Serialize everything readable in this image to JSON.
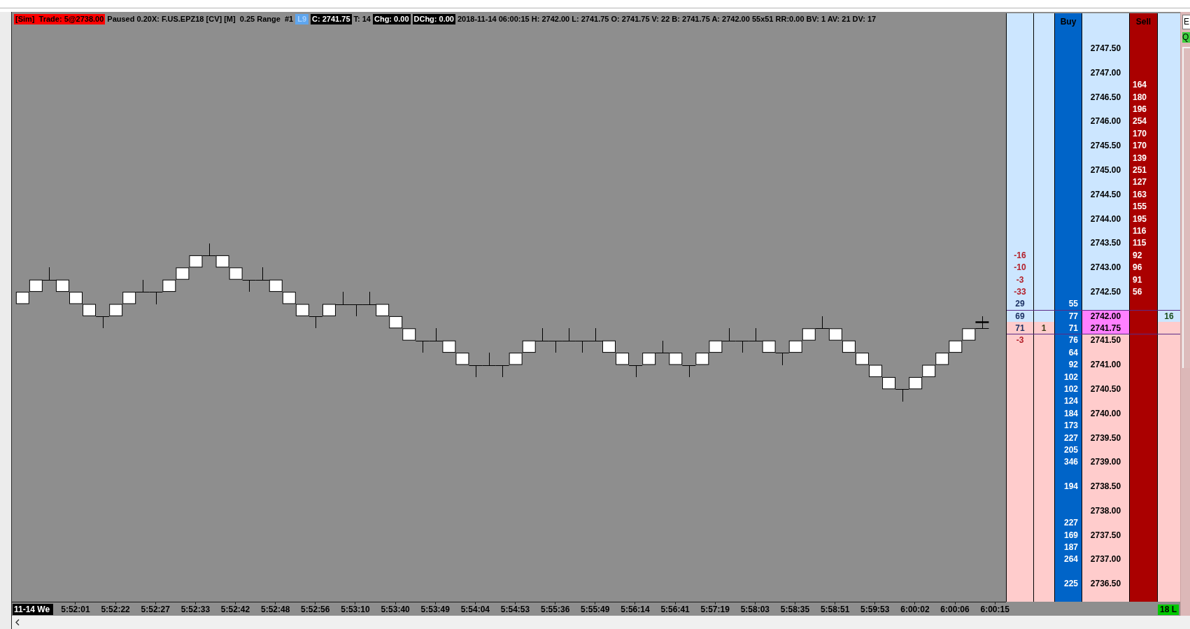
{
  "chart": {
    "header": [
      {
        "kind": "alert",
        "text": "[Sim]  Trade: 5@2738.00"
      },
      {
        "kind": "plain",
        "text": "Paused 0.20X: F.US.EPZ18 [CV] [M]  0.25 Range  #1"
      },
      {
        "kind": "tag",
        "text": "L9"
      },
      {
        "kind": "inverse",
        "text": "C: 2741.75"
      },
      {
        "kind": "plain",
        "text": "T: 14"
      },
      {
        "kind": "inverse",
        "text": "Chg: 0.00"
      },
      {
        "kind": "inverse",
        "text": "DChg: 0.00"
      },
      {
        "kind": "plain",
        "text": "2018-11-14 06:00:15 H: 2742.00 L: 2741.75 O: 2741.75 V: 22 B: 2741.75 A: 2742.00 55x51 RR:0.00 BV: 1 AV: 21 DV: 17"
      }
    ],
    "date_label": "11-14 We",
    "time_labels": [
      "5:52:01",
      "5:52:22",
      "5:52:27",
      "5:52:33",
      "5:52:42",
      "5:52:48",
      "5:52:56",
      "5:53:10",
      "5:53:40",
      "5:53:49",
      "5:54:04",
      "5:54:53",
      "5:55:36",
      "5:55:49",
      "5:56:14",
      "5:56:41",
      "5:57:19",
      "5:58:03",
      "5:58:35",
      "5:58:51",
      "5:59:53",
      "6:00:02",
      "6:00:06",
      "6:00:15"
    ]
  },
  "ladder": {
    "buy_label": "Buy",
    "sell_label": "Sell",
    "footer_tag": "18 L",
    "rows": [
      {
        "kind": "ask",
        "inside": false
      },
      {
        "price": "2747.50",
        "kind": "ask",
        "inside": false
      },
      {
        "kind": "ask",
        "inside": false
      },
      {
        "price": "2747.00",
        "kind": "ask",
        "inside": false
      },
      {
        "sell": "164",
        "kind": "ask",
        "inside": false
      },
      {
        "price": "2746.50",
        "sell": "180",
        "kind": "ask",
        "inside": false
      },
      {
        "sell": "196",
        "kind": "ask",
        "inside": false
      },
      {
        "price": "2746.00",
        "sell": "254",
        "kind": "ask",
        "inside": false
      },
      {
        "sell": "170",
        "kind": "ask",
        "inside": false
      },
      {
        "price": "2745.50",
        "sell": "170",
        "kind": "ask",
        "inside": false
      },
      {
        "sell": "139",
        "kind": "ask",
        "inside": false
      },
      {
        "price": "2745.00",
        "sell": "251",
        "kind": "ask",
        "inside": false
      },
      {
        "sell": "127",
        "kind": "ask",
        "inside": false
      },
      {
        "price": "2744.50",
        "sell": "163",
        "kind": "ask",
        "inside": false
      },
      {
        "sell": "155",
        "kind": "ask",
        "inside": false
      },
      {
        "price": "2744.00",
        "sell": "195",
        "kind": "ask",
        "inside": false
      },
      {
        "sell": "116",
        "kind": "ask",
        "inside": false
      },
      {
        "price": "2743.50",
        "sell": "115",
        "kind": "ask",
        "inside": false
      },
      {
        "delta": {
          "text": "-16",
          "color": "#b3202a"
        },
        "sell": "92",
        "kind": "ask",
        "inside": false
      },
      {
        "delta": {
          "text": "-10",
          "color": "#b3202a"
        },
        "price": "2743.00",
        "sell": "96",
        "kind": "ask",
        "inside": false
      },
      {
        "delta": {
          "text": "-3",
          "color": "#b3202a"
        },
        "sell": "91",
        "kind": "ask",
        "inside": false
      },
      {
        "delta": {
          "text": "-33",
          "color": "#b3202a"
        },
        "price": "2742.50",
        "sell": "56",
        "kind": "ask",
        "inside": false
      },
      {
        "delta": {
          "text": "29",
          "color": "#1e3264"
        },
        "buy": "55",
        "kind": "ask",
        "inside": false
      },
      {
        "delta": {
          "text": "69",
          "color": "#1e3264"
        },
        "buy": "77",
        "price": "2742.00",
        "col_6": "16",
        "kind": "ask",
        "inside": true
      },
      {
        "delta": {
          "text": "71",
          "color": "#1e3264"
        },
        "col_2": "1",
        "buy": "71",
        "price": "2741.75",
        "kind": "bid",
        "inside": true
      },
      {
        "delta": {
          "text": "-3",
          "color": "#b3202a"
        },
        "buy": "76",
        "price": "2741.50",
        "kind": "bid",
        "inside": false
      },
      {
        "buy": "64",
        "kind": "bid",
        "inside": false
      },
      {
        "buy": "92",
        "price": "2741.00",
        "kind": "bid",
        "inside": false
      },
      {
        "buy": "102",
        "kind": "bid",
        "inside": false
      },
      {
        "buy": "102",
        "price": "2740.50",
        "kind": "bid",
        "inside": false
      },
      {
        "buy": "124",
        "kind": "bid",
        "inside": false
      },
      {
        "buy": "184",
        "price": "2740.00",
        "kind": "bid",
        "inside": false
      },
      {
        "buy": "173",
        "kind": "bid",
        "inside": false
      },
      {
        "buy": "227",
        "price": "2739.50",
        "kind": "bid",
        "inside": false
      },
      {
        "buy": "205",
        "kind": "bid",
        "inside": false
      },
      {
        "buy": "346",
        "price": "2739.00",
        "kind": "bid",
        "inside": false
      },
      {
        "kind": "bid",
        "inside": false
      },
      {
        "buy": "194",
        "price": "2738.50",
        "kind": "bid",
        "inside": false
      },
      {
        "kind": "bid",
        "inside": false
      },
      {
        "price": "2738.00",
        "kind": "bid",
        "inside": false
      },
      {
        "buy": "227",
        "kind": "bid",
        "inside": false
      },
      {
        "buy": "169",
        "price": "2737.50",
        "kind": "bid",
        "inside": false
      },
      {
        "buy": "187",
        "kind": "bid",
        "inside": false
      },
      {
        "buy": "264",
        "price": "2737.00",
        "kind": "bid",
        "inside": false
      },
      {
        "kind": "bid",
        "inside": false
      },
      {
        "buy": "225",
        "price": "2736.50",
        "kind": "bid",
        "inside": false
      },
      {
        "kind": "bid",
        "inside": false
      }
    ]
  },
  "side_panel": {
    "field_value": "E",
    "tag": "Q"
  }
}
